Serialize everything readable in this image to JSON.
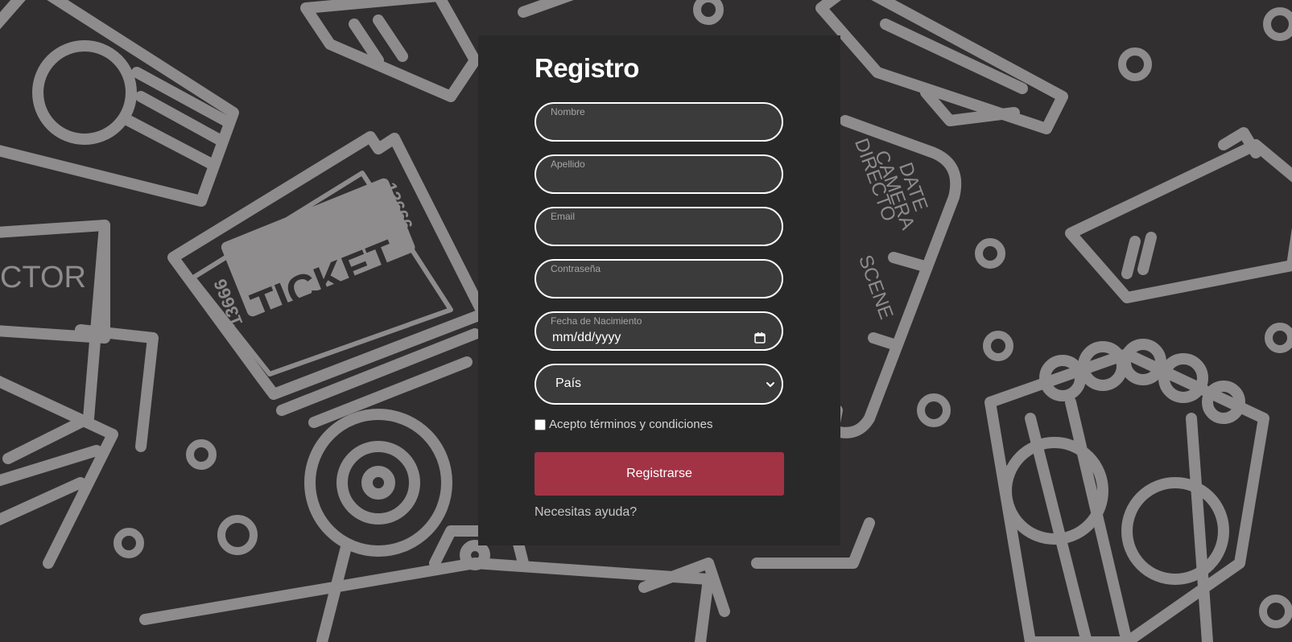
{
  "form": {
    "title": "Registro",
    "fields": [
      {
        "label": "Nombre",
        "value": ""
      },
      {
        "label": "Apellido",
        "value": ""
      },
      {
        "label": "Email",
        "value": ""
      },
      {
        "label": "Contraseña",
        "value": ""
      }
    ],
    "birthdate": {
      "label": "Fecha de Nacimiento",
      "placeholder": "mm/dd/yyyy"
    },
    "country": {
      "selected": "País"
    },
    "terms": {
      "label": "Acepto términos y condiciones",
      "checked": false
    },
    "submit_label": "Registrarse",
    "help_link": "Necesitas ayuda?"
  },
  "background": {
    "decorations": [
      "popcorn-icon",
      "ticket-icon",
      "3d-glasses-icon",
      "megaphone-icon",
      "clapperboard-icon",
      "film-reel-icon",
      "movie-camera-icon",
      "director-chair-icon"
    ],
    "ticket_text": "TICKET",
    "ticket_number": "13666",
    "chair_text": "CTOR",
    "clapper_words": [
      "DATE",
      "CAMERA",
      "DIRECTO",
      "SCENE"
    ]
  },
  "colors": {
    "background": "#322f30",
    "panel": "#2a2929",
    "field_bg": "#3c3b3b",
    "accent": "#a13345",
    "decoration": "#8e8c8c"
  }
}
